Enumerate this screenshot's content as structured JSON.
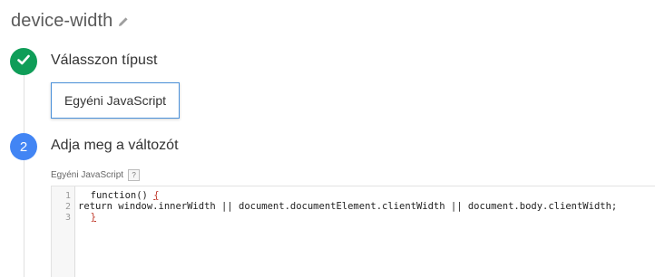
{
  "header": {
    "title": "device-width",
    "edit_icon": "pencil-icon"
  },
  "steps": [
    {
      "number": "",
      "status": "done",
      "label": "Válasszon típust",
      "icon": "check-icon",
      "color": "#0f9d58"
    },
    {
      "number": "2",
      "status": "active",
      "label": "Adja meg a változót",
      "color": "#4285f4"
    }
  ],
  "type_card": {
    "label": "Egyéni JavaScript"
  },
  "code_field": {
    "label": "Egyéni JavaScript",
    "help": "?",
    "line_numbers": [
      "1",
      "2",
      "3"
    ],
    "lines": [
      {
        "before": "  function() ",
        "brace": "{",
        "after": ""
      },
      {
        "text": "return window.innerWidth || document.documentElement.clientWidth || document.body.clientWidth;"
      },
      {
        "before": "  ",
        "brace": "}",
        "after": ""
      }
    ]
  }
}
